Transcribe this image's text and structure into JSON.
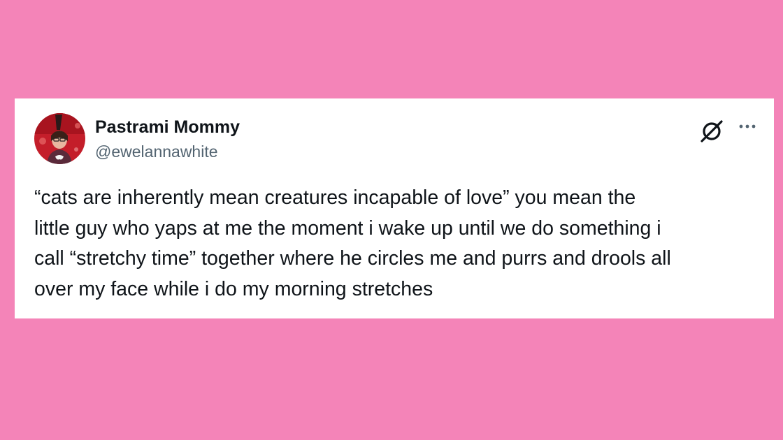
{
  "page": {
    "background_color": "#f484b8"
  },
  "tweet": {
    "author": {
      "display_name": "Pastrami Mommy",
      "handle": "@ewelannawhite",
      "avatar_icon": "profile-photo"
    },
    "text": "“cats are inherently mean creatures incapable of love” you mean the\nlittle guy who yaps at me the moment i wake up until we do something i\ncall “stretchy time” together where he circles me and purrs and drools all\nover my face while i do my morning stretches",
    "header_icons": [
      "x-logo-icon",
      "more-options-icon"
    ]
  },
  "colors": {
    "card_background": "#ffffff",
    "primary_text": "#0f1419",
    "secondary_text": "#536471"
  }
}
